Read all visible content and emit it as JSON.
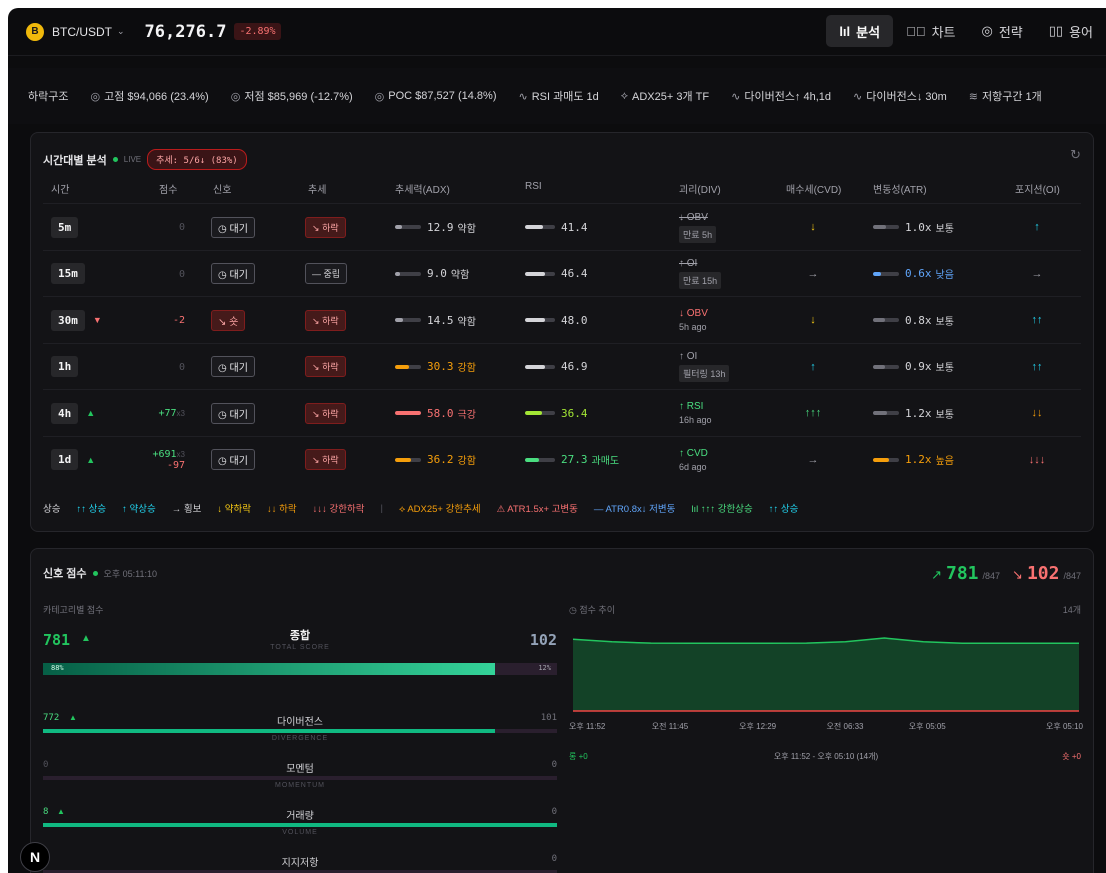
{
  "header": {
    "coin_letter": "B",
    "pair": "BTC/USDT",
    "price": "76,276.7",
    "change": "-2.89%",
    "nav": [
      {
        "label": "분석",
        "icon": "bar-chart-icon",
        "active": true
      },
      {
        "label": "차트",
        "icon": "chart-icon",
        "active": false
      },
      {
        "label": "전략",
        "icon": "target-icon",
        "active": false
      },
      {
        "label": "용어",
        "icon": "book-icon",
        "active": false
      }
    ]
  },
  "summary": [
    {
      "text": "하락구조",
      "icon": ""
    },
    {
      "text": "고점 $94,066 (23.4%)",
      "icon": "◎"
    },
    {
      "text": "저점 $85,969 (-12.7%)",
      "icon": "◎"
    },
    {
      "text": "POC $87,527 (14.8%)",
      "icon": "◎"
    },
    {
      "text": "RSI 과매도 1d",
      "icon": "∿"
    },
    {
      "text": "ADX25+ 3개 TF",
      "icon": "⟡"
    },
    {
      "text": "다이버전스↑ 4h,1d",
      "icon": "∿"
    },
    {
      "text": "다이버전스↓ 30m",
      "icon": "∿"
    },
    {
      "text": "저항구간 1개",
      "icon": "≋"
    }
  ],
  "timeframe": {
    "title": "시간대별 분석",
    "live": "LIVE",
    "trend_badge": "추세: 5/6↓ (83%)",
    "columns": [
      "시간",
      "점수",
      "신호",
      "추세",
      "추세력(ADX)",
      "RSI",
      "괴리(DIV)",
      "매수세(CVD)",
      "변동성(ATR)",
      "포지션(OI)"
    ],
    "rows": [
      {
        "tf": "5m",
        "tf_arrow": "",
        "score": "0",
        "score2": "",
        "mult": "",
        "signal": "대기",
        "sig_type": "wait",
        "trend": "하락",
        "trend_type": "down",
        "adx": "12.9",
        "adx_label": "약함",
        "adx_color": "#a1a1aa",
        "adx_level": 0.25,
        "rsi": "41.4",
        "rsi_color": "#d4d4d8",
        "rsi_level": 0.4,
        "div": "↓ OBV",
        "div_strike": true,
        "div_color": "#a1a1aa",
        "div_sub": "만료 5h",
        "div_chip": true,
        "cvd": "↓",
        "cvd_color": "#facc15",
        "atr": "1.0x",
        "atr_label": "보통",
        "atr_color": "#a1a1aa",
        "atr_level": 0.5,
        "oi": "↑",
        "oi_color": "#22d3ee"
      },
      {
        "tf": "15m",
        "tf_arrow": "",
        "score": "0",
        "score2": "",
        "mult": "",
        "signal": "대기",
        "sig_type": "wait",
        "trend": "중립",
        "trend_type": "neutral",
        "adx": "9.0",
        "adx_label": "약함",
        "adx_color": "#a1a1aa",
        "adx_level": 0.2,
        "rsi": "46.4",
        "rsi_color": "#d4d4d8",
        "rsi_level": 0.45,
        "div": "↑ OI",
        "div_strike": true,
        "div_color": "#a1a1aa",
        "div_sub": "만료 15h",
        "div_chip": true,
        "cvd": "→",
        "cvd_color": "#a1a1aa",
        "atr": "0.6x",
        "atr_label": "낮음",
        "atr_color": "#60a5fa",
        "atr_level": 0.3,
        "oi": "→",
        "oi_color": "#a1a1aa"
      },
      {
        "tf": "30m",
        "tf_arrow": "▼",
        "score": "-2",
        "score2": "",
        "mult": "",
        "signal": "숏",
        "sig_type": "sell",
        "trend": "하락",
        "trend_type": "down",
        "adx": "14.5",
        "adx_label": "약함",
        "adx_color": "#a1a1aa",
        "adx_level": 0.3,
        "rsi": "48.0",
        "rsi_color": "#d4d4d8",
        "rsi_level": 0.48,
        "div": "↓ OBV",
        "div_strike": false,
        "div_color": "#f87171",
        "div_sub": "5h ago",
        "div_chip": false,
        "cvd": "↓",
        "cvd_color": "#facc15",
        "atr": "0.8x",
        "atr_label": "보통",
        "atr_color": "#a1a1aa",
        "atr_level": 0.45,
        "oi": "↑↑",
        "oi_color": "#22d3ee"
      },
      {
        "tf": "1h",
        "tf_arrow": "",
        "score": "0",
        "score2": "",
        "mult": "",
        "signal": "대기",
        "sig_type": "wait",
        "trend": "하락",
        "trend_type": "down",
        "adx": "30.3",
        "adx_label": "강함",
        "adx_color": "#f59e0b",
        "adx_level": 0.55,
        "rsi": "46.9",
        "rsi_color": "#d4d4d8",
        "rsi_level": 0.47,
        "div": "↑ OI",
        "div_strike": false,
        "div_color": "#a1a1aa",
        "div_sub": "필터링 13h",
        "div_chip": true,
        "cvd": "↑",
        "cvd_color": "#22d3ee",
        "atr": "0.9x",
        "atr_label": "보통",
        "atr_color": "#a1a1aa",
        "atr_level": 0.48,
        "oi": "↑↑",
        "oi_color": "#22d3ee"
      },
      {
        "tf": "4h",
        "tf_arrow": "▲",
        "score": "+77",
        "score2": "",
        "mult": "x3",
        "signal": "대기",
        "sig_type": "wait",
        "trend": "하락",
        "trend_type": "down",
        "adx": "58.0",
        "adx_label": "극강",
        "adx_color": "#f87171",
        "adx_level": 1.0,
        "rsi": "36.4",
        "rsi_color": "#a3e635",
        "rsi_level": 0.36,
        "div": "↑ RSI",
        "div_strike": false,
        "div_color": "#4ade80",
        "div_sub": "16h ago",
        "div_chip": false,
        "cvd": "↑↑↑",
        "cvd_color": "#4ade80",
        "atr": "1.2x",
        "atr_label": "보통",
        "atr_color": "#a1a1aa",
        "atr_level": 0.55,
        "oi": "↓↓",
        "oi_color": "#f59e0b"
      },
      {
        "tf": "1d",
        "tf_arrow": "▲",
        "score": "+691",
        "score2": "-97",
        "mult": "x3",
        "signal": "대기",
        "sig_type": "wait",
        "trend": "하락",
        "trend_type": "down",
        "adx": "36.2",
        "adx_label": "강함",
        "adx_color": "#f59e0b",
        "adx_level": 0.6,
        "rsi": "27.3",
        "rsi_color": "#4ade80",
        "rsi_level": 0.27,
        "rsi_label": "과매도",
        "div": "↑ CVD",
        "div_strike": false,
        "div_color": "#4ade80",
        "div_sub": "6d ago",
        "div_chip": false,
        "cvd": "→",
        "cvd_color": "#a1a1aa",
        "atr": "1.2x",
        "atr_label": "높음",
        "atr_color": "#f59e0b",
        "atr_level": 0.6,
        "oi": "↓↓↓",
        "oi_color": "#f87171"
      }
    ],
    "legend": [
      {
        "text": "상승",
        "color": "#d4d4d8"
      },
      {
        "text": "↑↑ 상승",
        "color": "#22d3ee"
      },
      {
        "text": "↑ 약상승",
        "color": "#22d3ee"
      },
      {
        "text": "→ 횡보",
        "color": "#d4d4d8"
      },
      {
        "text": "↓ 약하락",
        "color": "#facc15"
      },
      {
        "text": "↓↓ 하락",
        "color": "#f59e0b"
      },
      {
        "text": "↓↓↓ 강한하락",
        "color": "#f87171"
      },
      {
        "text": "|",
        "color": "#52525b"
      },
      {
        "text": "⟡ ADX25+ 강한추세",
        "color": "#f59e0b"
      },
      {
        "text": "⚠ ATR1.5x+ 고변동",
        "color": "#f87171"
      },
      {
        "text": "— ATR0.8x↓ 저변동",
        "color": "#60a5fa"
      },
      {
        "text": "lıl ↑↑↑ 강한상승",
        "color": "#4ade80"
      },
      {
        "text": "↑↑ 상승",
        "color": "#22d3ee"
      }
    ]
  },
  "signal_score": {
    "title": "신호 점수",
    "time": "오후 05:11:10",
    "long_total": "781",
    "long_max": "/847",
    "short_total": "102",
    "short_max": "/847",
    "category_label": "카테고리별 점수",
    "long_score": "781",
    "total_label": "종합",
    "total_en": "TOTAL SCORE",
    "short_score": "102",
    "long_pct": "88%",
    "short_pct": "12%",
    "long_fraction": 0.88,
    "categories": [
      {
        "long": "772",
        "long_arrow": "▲",
        "name": "다이버전스",
        "en": "DIVERGENCE",
        "short": "101",
        "fraction": 0.88
      },
      {
        "long": "0",
        "long_arrow": "",
        "name": "모멘텀",
        "en": "MOMENTUM",
        "short": "0",
        "fraction": 0.0
      },
      {
        "long": "8",
        "long_arrow": "▲",
        "name": "거래량",
        "en": "VOLUME",
        "short": "0",
        "fraction": 1.0
      },
      {
        "long": "",
        "long_arrow": "",
        "name": "지지저항",
        "en": "",
        "short": "0",
        "fraction": 0.0
      }
    ],
    "trend_label": "점수 추이",
    "trend_count": "14개",
    "x_ticks": [
      "오후 11:52",
      "오전 11:45",
      "오후 12:29",
      "오전 06:33",
      "오후 05:05",
      "오후 05:10"
    ],
    "range_text": "오후 11:52 - 오후 05:10 (14개)",
    "long_delta": "롱 +0",
    "short_delta": "숏 +0"
  },
  "chart_data": {
    "type": "area",
    "x": [
      "오후 11:52",
      "",
      "",
      "오전 11:45",
      "",
      "",
      "오후 12:29",
      "",
      "",
      "오전 06:33",
      "",
      "",
      "오후 05:05",
      "오후 05:10"
    ],
    "series": [
      {
        "values": [
          805,
          790,
          782,
          781,
          781,
          781,
          782,
          790,
          812,
          790,
          781,
          781,
          781,
          781
        ],
        "color": "#22c55e"
      },
      {
        "values": [
          102,
          102,
          102,
          102,
          102,
          102,
          102,
          102,
          102,
          102,
          102,
          102,
          102,
          102
        ],
        "color": "#ef4444"
      }
    ],
    "ylim": [
      0,
      847
    ]
  },
  "avatar_letter": "N"
}
